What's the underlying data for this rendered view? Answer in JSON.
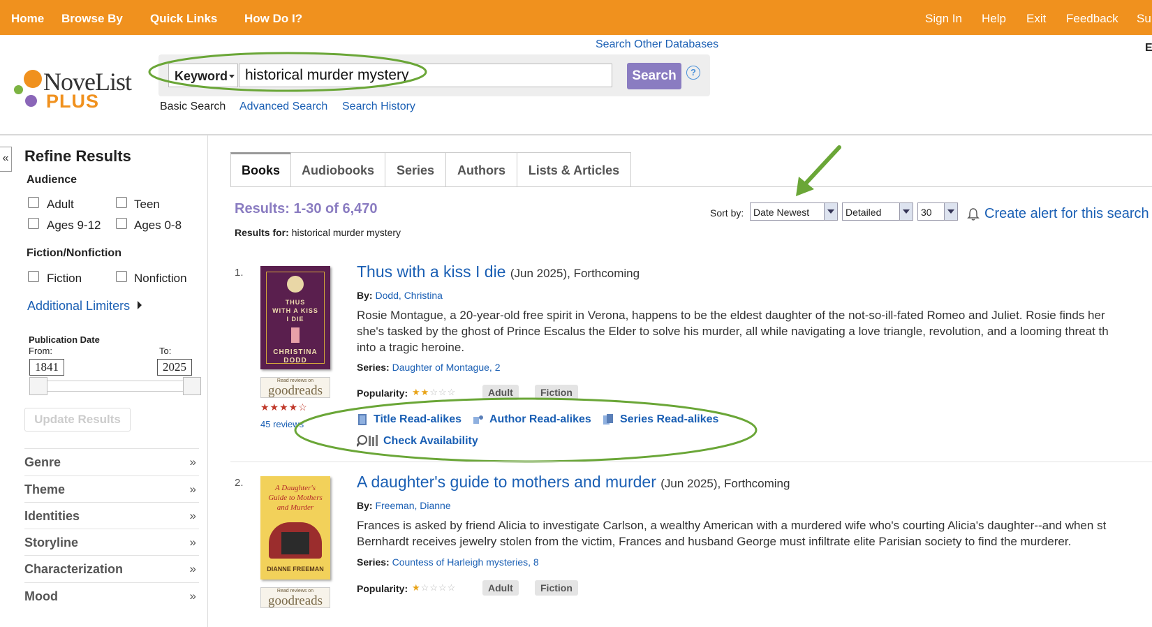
{
  "topnav": {
    "left": [
      "Home",
      "Browse By",
      "Quick Links",
      "How Do I?"
    ],
    "right": [
      "Sign In",
      "Help",
      "Exit",
      "Feedback",
      "Su"
    ]
  },
  "header": {
    "logo_main": "NoveList",
    "logo_plus": "PLUS",
    "search_other": "Search Other Databases",
    "search_field": "Keyword",
    "query": "historical murder mystery",
    "search_button": "Search",
    "help": "?",
    "subnav": [
      "Basic Search",
      "Advanced Search",
      "Search History"
    ],
    "right_edge": "E"
  },
  "sidebar": {
    "collapse": "«",
    "title": "Refine Results",
    "audience": {
      "label": "Audience",
      "options": [
        "Adult",
        "Teen",
        "Ages 9-12",
        "Ages 0-8"
      ]
    },
    "fiction": {
      "label": "Fiction/Nonfiction",
      "options": [
        "Fiction",
        "Nonfiction"
      ]
    },
    "additional": "Additional Limiters",
    "pubdate": {
      "label": "Publication Date",
      "from_label": "From:",
      "to_label": "To:",
      "from": "1841",
      "to": "2025"
    },
    "update": "Update Results",
    "facets": [
      "Genre",
      "Theme",
      "Identities",
      "Storyline",
      "Characterization",
      "Mood"
    ],
    "facet_arrow": "»"
  },
  "tabs": [
    "Books",
    "Audiobooks",
    "Series",
    "Authors",
    "Lists & Articles"
  ],
  "results": {
    "count": "Results: 1-30 of 6,470",
    "for_label": "Results for:",
    "for_value": "historical murder mystery",
    "sort_label": "Sort by:",
    "sort": "Date Newest",
    "view": "Detailed",
    "per_page": "30",
    "alert": "Create alert for this search"
  },
  "items": [
    {
      "num": "1.",
      "title": "Thus with a kiss I die",
      "extra": "(Jun 2025), Forthcoming",
      "by_label": "By:",
      "author": "Dodd, Christina",
      "desc": [
        "Rosie Montague, a 20-year-old free spirit in Verona, happens to be the eldest daughter of the not-so-ill-fated Romeo and Juliet. Rosie finds her",
        "she's tasked by the ghost of Prince Escalus the Elder to solve his murder, all while navigating a love triangle, revolution, and a looming threat th",
        "into a tragic heroine."
      ],
      "series_label": "Series:",
      "series": "Daughter of Montague, 2",
      "pop_label": "Popularity:",
      "popularity": 2,
      "badges": [
        "Adult",
        "Fiction"
      ],
      "cover": {
        "t1": "THUS",
        "t2": "WITH A KISS",
        "t3": "I DIE",
        "a1": "CHRISTINA",
        "a2": "DODD"
      },
      "gr_small": "Read reviews on",
      "gr_logo": "goodreads",
      "gr_stars": "★★★★☆",
      "reviews": "45 reviews",
      "readalikes": [
        "Title Read-alikes",
        "Author Read-alikes",
        "Series Read-alikes"
      ],
      "availability": "Check Availability"
    },
    {
      "num": "2.",
      "title": "A daughter's guide to mothers and murder",
      "extra": "(Jun 2025), Forthcoming",
      "by_label": "By:",
      "author": "Freeman, Dianne",
      "desc": [
        "Frances is asked by friend Alicia to investigate Carlson, a wealthy American with a murdered wife who's courting Alicia's daughter--and when st",
        "Bernhardt receives jewelry stolen from the victim, Frances and husband George must infiltrate elite Parisian society to find the murderer."
      ],
      "series_label": "Series:",
      "series": "Countess of Harleigh mysteries, 8",
      "pop_label": "Popularity:",
      "popularity": 1,
      "badges": [
        "Adult",
        "Fiction"
      ],
      "cover": {
        "t1": "A Daughter's",
        "t2": "Guide to Mothers",
        "t3": "and Murder",
        "a1": "DIANNE FREEMAN"
      },
      "gr_small": "Read reviews on",
      "gr_logo": "goodreads"
    }
  ],
  "colors": {
    "nav": "#f0911e",
    "accent_purple": "#8a7cc1",
    "link": "#1a5fb4",
    "highlight_green": "#6aa637"
  }
}
